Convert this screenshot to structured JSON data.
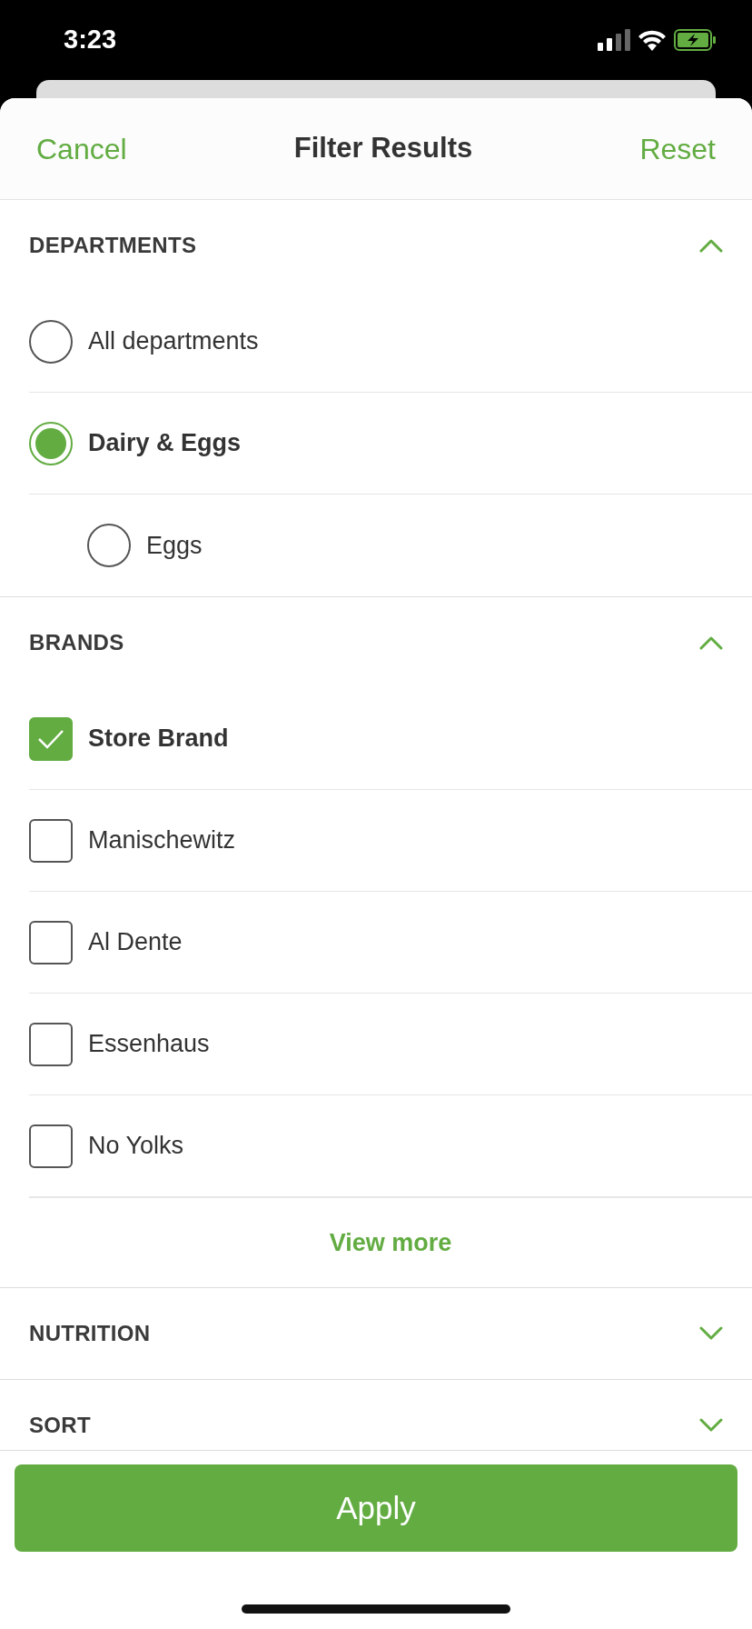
{
  "status_bar": {
    "time": "3:23"
  },
  "header": {
    "cancel": "Cancel",
    "title": "Filter Results",
    "reset": "Reset"
  },
  "sections": [
    {
      "title": "DEPARTMENTS",
      "expanded": true,
      "kind": "radio",
      "options": [
        {
          "label": "All departments",
          "selected": false
        },
        {
          "label": "Dairy & Eggs",
          "selected": true,
          "children": [
            {
              "label": "Eggs",
              "selected": false
            }
          ]
        }
      ]
    },
    {
      "title": "BRANDS",
      "expanded": true,
      "kind": "checkbox",
      "options": [
        {
          "label": "Store Brand",
          "checked": true
        },
        {
          "label": "Manischewitz",
          "checked": false
        },
        {
          "label": "Al Dente",
          "checked": false
        },
        {
          "label": "Essenhaus",
          "checked": false
        },
        {
          "label": "No Yolks",
          "checked": false
        }
      ],
      "more": "View more"
    },
    {
      "title": "NUTRITION",
      "expanded": false
    },
    {
      "title": "SORT",
      "expanded": false
    }
  ],
  "apply": "Apply"
}
